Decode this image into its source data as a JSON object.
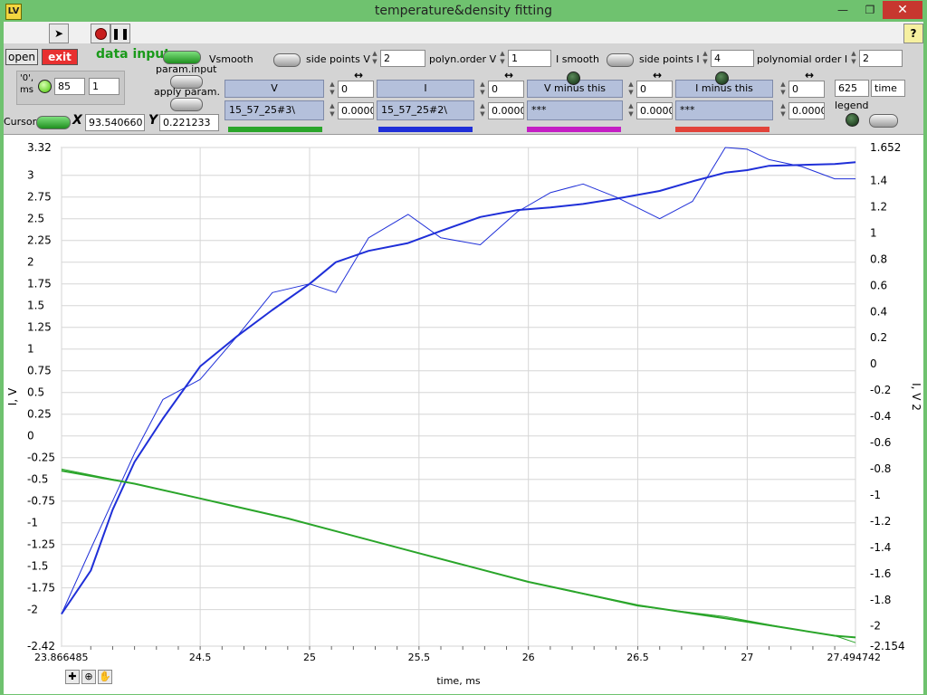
{
  "window": {
    "title": "temperature&density fitting",
    "app_icon": "LV",
    "minimize": "—",
    "maximize": "❐",
    "close": "✕"
  },
  "toolbar": {
    "run_icon": "run-arrow-icon",
    "stop_icon": "abort-icon",
    "pause_icon": "pause-icon",
    "help": "?"
  },
  "panel": {
    "open_label": "open",
    "exit_label": "exit",
    "data_input_label": "data input",
    "zero_ms_label": "'0',\nms",
    "zero_ms_value": "85",
    "zero_ms_value2": "1",
    "param_input_label": "param.input",
    "apply_param_label": "apply param.",
    "cursor_label": "Cursor",
    "x_label": "X",
    "x_value": "93.540660",
    "y_label": "Y",
    "y_value": "0.221233",
    "vsmooth_label": "Vsmooth",
    "side_points_v_label": "side points V",
    "side_points_v_value": "2",
    "polyn_order_v_label": "polyn.order V",
    "polyn_order_v_value": "1",
    "ismooth_label": "I smooth",
    "side_points_i_label": "side points I",
    "side_points_i_value": "4",
    "polyn_order_i_label": "polynomial order I",
    "polyn_order_i_value": "2",
    "time_value": "625",
    "time_label": "time",
    "legend_label": "legend",
    "channels": [
      {
        "header": "V",
        "file": "15_57_25#3\\",
        "shift": "0",
        "offset": "0.0000",
        "color": "#2aa52a"
      },
      {
        "header": "I",
        "file": "15_57_25#2\\",
        "shift": "0",
        "offset": "0.0000",
        "color": "#1f2fd8"
      },
      {
        "header": "V minus this",
        "file": "***",
        "shift": "0",
        "offset": "0.0000",
        "color": "#c41ec4"
      },
      {
        "header": "I minus this",
        "file": "***",
        "shift": "0",
        "offset": "0.0000",
        "color": "#e2433a"
      }
    ]
  },
  "chart_data": {
    "type": "line",
    "title": "",
    "xlabel": "time, ms",
    "ylabel": "I, V",
    "y2label": "I, V 2",
    "xlim": [
      23.866485,
      27.494742
    ],
    "ylim": [
      -2.42,
      3.32
    ],
    "y2lim": [
      -2.154,
      1.652
    ],
    "xticks": [
      "23.866485",
      "24.5",
      "25",
      "25.5",
      "26",
      "26.5",
      "27",
      "27.494742"
    ],
    "xtick_values": [
      23.866485,
      24.5,
      25,
      25.5,
      26,
      26.5,
      27,
      27.494742
    ],
    "yticks": [
      "3.32",
      "3",
      "2.75",
      "2.5",
      "2.25",
      "2",
      "1.75",
      "1.5",
      "1.25",
      "1",
      "0.75",
      "0.5",
      "0.25",
      "0",
      "-0.25",
      "-0.5",
      "-0.75",
      "-1",
      "-1.25",
      "-1.5",
      "-1.75",
      "-2",
      "-2.42"
    ],
    "ytick_values": [
      3.32,
      3,
      2.75,
      2.5,
      2.25,
      2,
      1.75,
      1.5,
      1.25,
      1,
      0.75,
      0.5,
      0.25,
      0,
      -0.25,
      -0.5,
      -0.75,
      -1,
      -1.25,
      -1.5,
      -1.75,
      -2,
      -2.42
    ],
    "y2ticks": [
      "1.652",
      "1.4",
      "1.2",
      "1",
      "0.8",
      "0.6",
      "0.4",
      "0.2",
      "0",
      "-0.2",
      "-0.4",
      "-0.6",
      "-0.8",
      "-1",
      "-1.2",
      "-1.4",
      "-1.6",
      "-1.8",
      "-2",
      "-2.154"
    ],
    "y2tick_values": [
      1.652,
      1.4,
      1.2,
      1,
      0.8,
      0.6,
      0.4,
      0.2,
      0,
      -0.2,
      -0.4,
      -0.6,
      -0.8,
      -1,
      -1.2,
      -1.4,
      -1.6,
      -1.8,
      -2,
      -2.154
    ],
    "grid": true,
    "series": [
      {
        "color": "#1f2fd8",
        "width": 1,
        "axis": "y",
        "x": [
          23.866,
          24.0,
          24.1,
          24.2,
          24.33,
          24.5,
          24.67,
          24.83,
          25.0,
          25.12,
          25.27,
          25.45,
          25.6,
          25.78,
          25.95,
          26.1,
          26.25,
          26.4,
          26.6,
          26.75,
          26.9,
          27.0,
          27.1,
          27.25,
          27.4,
          27.495
        ],
        "y": [
          -2.05,
          -1.3,
          -0.75,
          -0.2,
          0.42,
          0.65,
          1.15,
          1.65,
          1.75,
          1.65,
          2.28,
          2.55,
          2.28,
          2.2,
          2.58,
          2.8,
          2.9,
          2.75,
          2.5,
          2.7,
          3.32,
          3.3,
          3.18,
          3.1,
          2.96,
          2.96
        ]
      },
      {
        "color": "#1f2fd8",
        "width": 2,
        "axis": "y",
        "x": [
          23.866,
          24.0,
          24.1,
          24.2,
          24.33,
          24.5,
          24.67,
          24.83,
          25.0,
          25.12,
          25.27,
          25.45,
          25.6,
          25.78,
          25.95,
          26.1,
          26.25,
          26.4,
          26.6,
          26.75,
          26.9,
          27.0,
          27.1,
          27.25,
          27.4,
          27.495
        ],
        "y": [
          -2.05,
          -1.55,
          -0.85,
          -0.3,
          0.2,
          0.8,
          1.15,
          1.45,
          1.75,
          2.0,
          2.13,
          2.22,
          2.36,
          2.52,
          2.6,
          2.63,
          2.67,
          2.73,
          2.82,
          2.93,
          3.03,
          3.06,
          3.11,
          3.12,
          3.13,
          3.15
        ]
      },
      {
        "color": "#2aa52a",
        "width": 1,
        "axis": "y",
        "x": [
          23.866,
          24.2,
          24.5,
          24.9,
          25.5,
          26.0,
          26.5,
          26.9,
          27.2,
          27.4,
          27.495
        ],
        "y": [
          -0.38,
          -0.55,
          -0.72,
          -0.95,
          -1.35,
          -1.68,
          -1.96,
          -2.08,
          -2.22,
          -2.3,
          -2.38
        ]
      },
      {
        "color": "#2aa52a",
        "width": 2,
        "axis": "y",
        "x": [
          23.866,
          24.2,
          24.5,
          24.9,
          25.5,
          26.0,
          26.5,
          26.9,
          27.2,
          27.4,
          27.495
        ],
        "y": [
          -0.4,
          -0.55,
          -0.72,
          -0.95,
          -1.35,
          -1.68,
          -1.95,
          -2.1,
          -2.22,
          -2.3,
          -2.32
        ]
      }
    ]
  }
}
